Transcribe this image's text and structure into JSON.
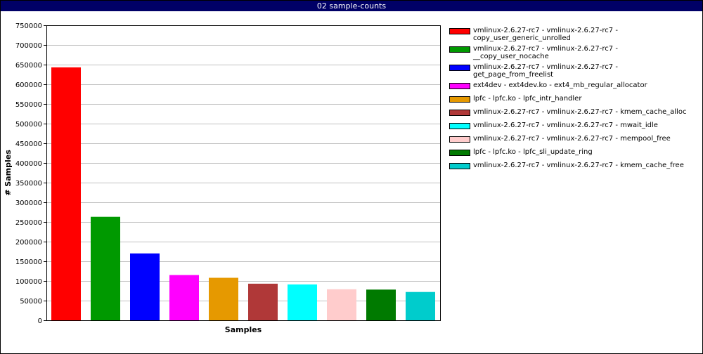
{
  "window": {
    "title": "02 sample-counts"
  },
  "chart_data": {
    "type": "bar",
    "title": "02 sample-counts",
    "xlabel": "Samples",
    "ylabel": "# Samples",
    "ylim": [
      0,
      750000
    ],
    "yticks": [
      0,
      50000,
      100000,
      150000,
      200000,
      250000,
      300000,
      350000,
      400000,
      450000,
      500000,
      550000,
      600000,
      650000,
      700000,
      750000
    ],
    "grid": true,
    "legend_position": "right",
    "series": [
      {
        "name": "vmlinux-2.6.27-rc7 - vmlinux-2.6.27-rc7 - copy_user_generic_unrolled",
        "label_lines": [
          "vmlinux-2.6.27-rc7 - vmlinux-2.6.27-rc7 -",
          "copy_user_generic_unrolled"
        ],
        "value": 643000,
        "color": "#ff0000"
      },
      {
        "name": "vmlinux-2.6.27-rc7 - vmlinux-2.6.27-rc7 - __copy_user_nocache",
        "label_lines": [
          "vmlinux-2.6.27-rc7 - vmlinux-2.6.27-rc7 -",
          "__copy_user_nocache"
        ],
        "value": 263000,
        "color": "#009900"
      },
      {
        "name": "vmlinux-2.6.27-rc7 - vmlinux-2.6.27-rc7 - get_page_from_freelist",
        "label_lines": [
          "vmlinux-2.6.27-rc7 - vmlinux-2.6.27-rc7 -",
          "get_page_from_freelist"
        ],
        "value": 170000,
        "color": "#0000ff"
      },
      {
        "name": "ext4dev - ext4dev.ko - ext4_mb_regular_allocator",
        "label_lines": [
          "ext4dev - ext4dev.ko - ext4_mb_regular_allocator"
        ],
        "value": 115000,
        "color": "#ff00ff"
      },
      {
        "name": "lpfc - lpfc.ko - lpfc_intr_handler",
        "label_lines": [
          "lpfc - lpfc.ko - lpfc_intr_handler"
        ],
        "value": 108000,
        "color": "#e69900"
      },
      {
        "name": "vmlinux-2.6.27-rc7 - vmlinux-2.6.27-rc7 - kmem_cache_alloc",
        "label_lines": [
          "vmlinux-2.6.27-rc7 - vmlinux-2.6.27-rc7 - kmem_cache_alloc"
        ],
        "value": 93000,
        "color": "#b03838"
      },
      {
        "name": "vmlinux-2.6.27-rc7 - vmlinux-2.6.27-rc7 - mwait_idle",
        "label_lines": [
          "vmlinux-2.6.27-rc7 - vmlinux-2.6.27-rc7 - mwait_idle"
        ],
        "value": 91000,
        "color": "#00ffff"
      },
      {
        "name": "vmlinux-2.6.27-rc7 - vmlinux-2.6.27-rc7 - mempool_free",
        "label_lines": [
          "vmlinux-2.6.27-rc7 - vmlinux-2.6.27-rc7 - mempool_free"
        ],
        "value": 79000,
        "color": "#ffcccc"
      },
      {
        "name": "lpfc - lpfc.ko - lpfc_sli_update_ring",
        "label_lines": [
          "lpfc - lpfc.ko - lpfc_sli_update_ring"
        ],
        "value": 78000,
        "color": "#007a00"
      },
      {
        "name": "vmlinux-2.6.27-rc7 - vmlinux-2.6.27-rc7 - kmem_cache_free",
        "label_lines": [
          "vmlinux-2.6.27-rc7 - vmlinux-2.6.27-rc7 - kmem_cache_free"
        ],
        "value": 72000,
        "color": "#00cccc"
      }
    ]
  }
}
